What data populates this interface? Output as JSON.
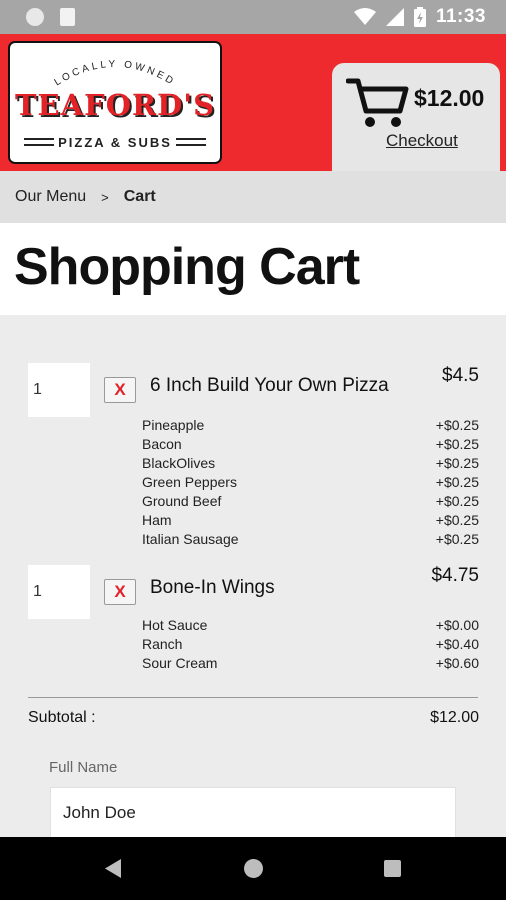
{
  "status_bar": {
    "time": "11:33"
  },
  "header": {
    "logo": {
      "top_text": "LOCALLY OWNED",
      "name": "TEAFORD'S",
      "subtitle": "PIZZA & SUBS"
    },
    "cart": {
      "total": "$12.00",
      "checkout_label": "Checkout"
    }
  },
  "breadcrumb": {
    "menu_label": "Our Menu",
    "separator": ">",
    "current": "Cart"
  },
  "page": {
    "title": "Shopping Cart"
  },
  "items": [
    {
      "qty": "1",
      "remove_label": "X",
      "name": "6 Inch Build Your Own Pizza",
      "price": "$4.5",
      "options": [
        {
          "name": "Pineapple",
          "price": "+$0.25"
        },
        {
          "name": "Bacon",
          "price": "+$0.25"
        },
        {
          "name": "BlackOlives",
          "price": "+$0.25"
        },
        {
          "name": "Green Peppers",
          "price": "+$0.25"
        },
        {
          "name": "Ground Beef",
          "price": "+$0.25"
        },
        {
          "name": "Ham",
          "price": "+$0.25"
        },
        {
          "name": "Italian Sausage",
          "price": "+$0.25"
        }
      ]
    },
    {
      "qty": "1",
      "remove_label": "X",
      "name": "Bone-In Wings",
      "price": "$4.75",
      "options": [
        {
          "name": "Hot Sauce",
          "price": "+$0.00"
        },
        {
          "name": "Ranch",
          "price": "+$0.40"
        },
        {
          "name": "Sour Cream",
          "price": "+$0.60"
        }
      ]
    }
  ],
  "summary": {
    "subtotal_label": "Subtotal :",
    "subtotal_value": "$12.00"
  },
  "form": {
    "full_name_label": "Full Name",
    "full_name_value": "John Doe"
  },
  "colors": {
    "brand_red": "#ee2a2f",
    "remove_red": "#e32227"
  }
}
